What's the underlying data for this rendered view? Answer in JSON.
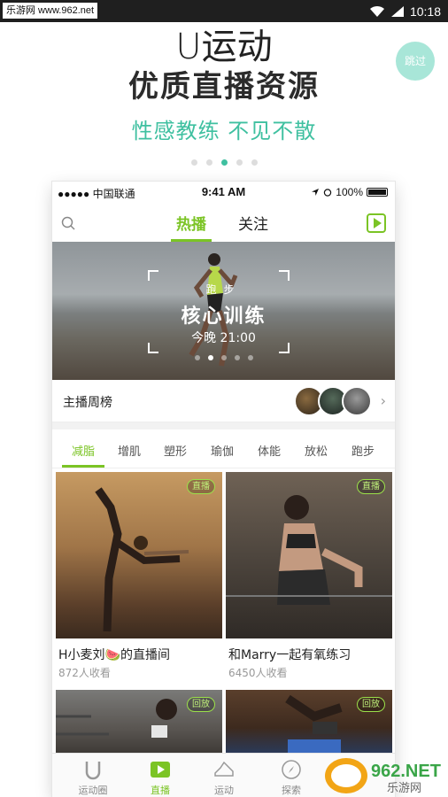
{
  "status_bar": {
    "watermark": "乐游网 www.962.net",
    "time": "10:18"
  },
  "promo": {
    "logo_text": "U运动",
    "headline": "优质直播资源",
    "subline": "性感教练 不见不散",
    "skip_label": "跳过",
    "page_dots": {
      "count": 5,
      "active_index": 2
    }
  },
  "phone": {
    "ios_status": {
      "carrier": "●●●●● 中国联通",
      "time": "9:41 AM",
      "battery": "100%"
    },
    "tabs": {
      "hot": "热播",
      "follow": "关注"
    },
    "banner": {
      "category": "跑步",
      "title": "核心训练",
      "time": "今晚 21:00",
      "dots": {
        "count": 5,
        "active_index": 1
      }
    },
    "ranking": {
      "label": "主播周榜"
    },
    "categories": [
      "减脂",
      "增肌",
      "塑形",
      "瑜伽",
      "体能",
      "放松",
      "跑步"
    ],
    "cards": [
      {
        "badge": "直播",
        "title": "H小麦刘🍉的直播间",
        "viewers": "872人收看"
      },
      {
        "badge": "直播",
        "title": "和Marry一起有氧练习",
        "viewers": "6450人收看"
      },
      {
        "badge": "回放",
        "title": "",
        "viewers": ""
      },
      {
        "badge": "回放",
        "title": "",
        "viewers": ""
      }
    ],
    "tabbar": [
      {
        "label": "运动圈",
        "icon": "u-logo-icon"
      },
      {
        "label": "直播",
        "icon": "play-icon"
      },
      {
        "label": "运动",
        "icon": "shoe-icon"
      },
      {
        "label": "探索",
        "icon": "compass-icon"
      }
    ]
  },
  "corner_watermark": {
    "text": "962.NET",
    "sub": "乐游网"
  },
  "colors": {
    "accent_green": "#7bc425",
    "teal": "#3fc0a0"
  }
}
